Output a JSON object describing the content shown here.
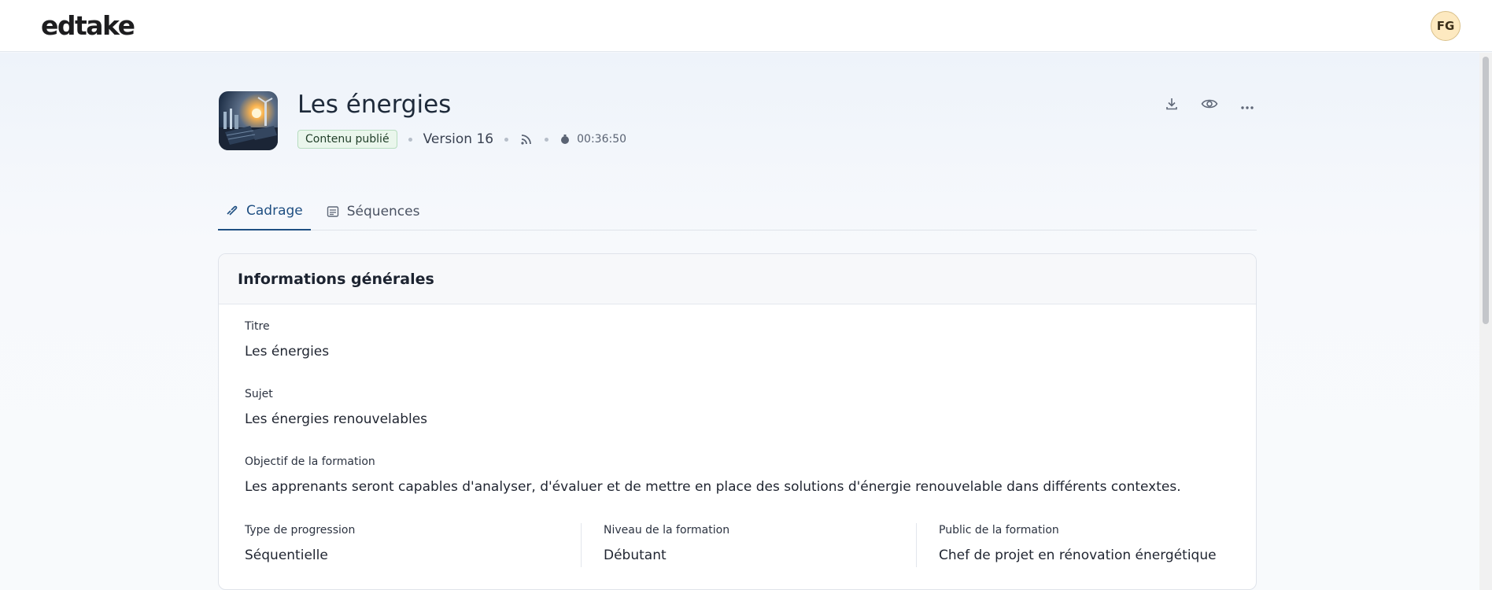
{
  "app": {
    "logo": "edtake",
    "user_initials": "FG"
  },
  "course": {
    "title": "Les énergies",
    "status_badge": "Contenu publié",
    "version": "Version 16",
    "duration": "00:36:50",
    "actions": [
      "download-icon",
      "eye-icon",
      "more-horizontal-icon"
    ]
  },
  "tabs": [
    {
      "label": "Cadrage",
      "icon": "link-icon",
      "active": true
    },
    {
      "label": "Séquences",
      "icon": "list-icon",
      "active": false
    }
  ],
  "card": {
    "title": "Informations générales",
    "fields": {
      "titre": {
        "label": "Titre",
        "value": "Les énergies"
      },
      "sujet": {
        "label": "Sujet",
        "value": "Les énergies renouvelables"
      },
      "objectif": {
        "label": "Objectif de la formation",
        "value": "Les apprenants seront capables d'analyser, d'évaluer et de mettre en place des solutions d'énergie renouvelable dans différents contextes."
      },
      "progression": {
        "label": "Type de progression",
        "value": "Séquentielle"
      },
      "niveau": {
        "label": "Niveau de la formation",
        "value": "Débutant"
      },
      "public": {
        "label": "Public de la formation",
        "value": "Chef de projet en rénovation énergétique"
      }
    }
  },
  "colors": {
    "accent": "#1f4f82",
    "badge_bg": "#eaf6ec",
    "avatar_bg": "#fde9c0"
  }
}
